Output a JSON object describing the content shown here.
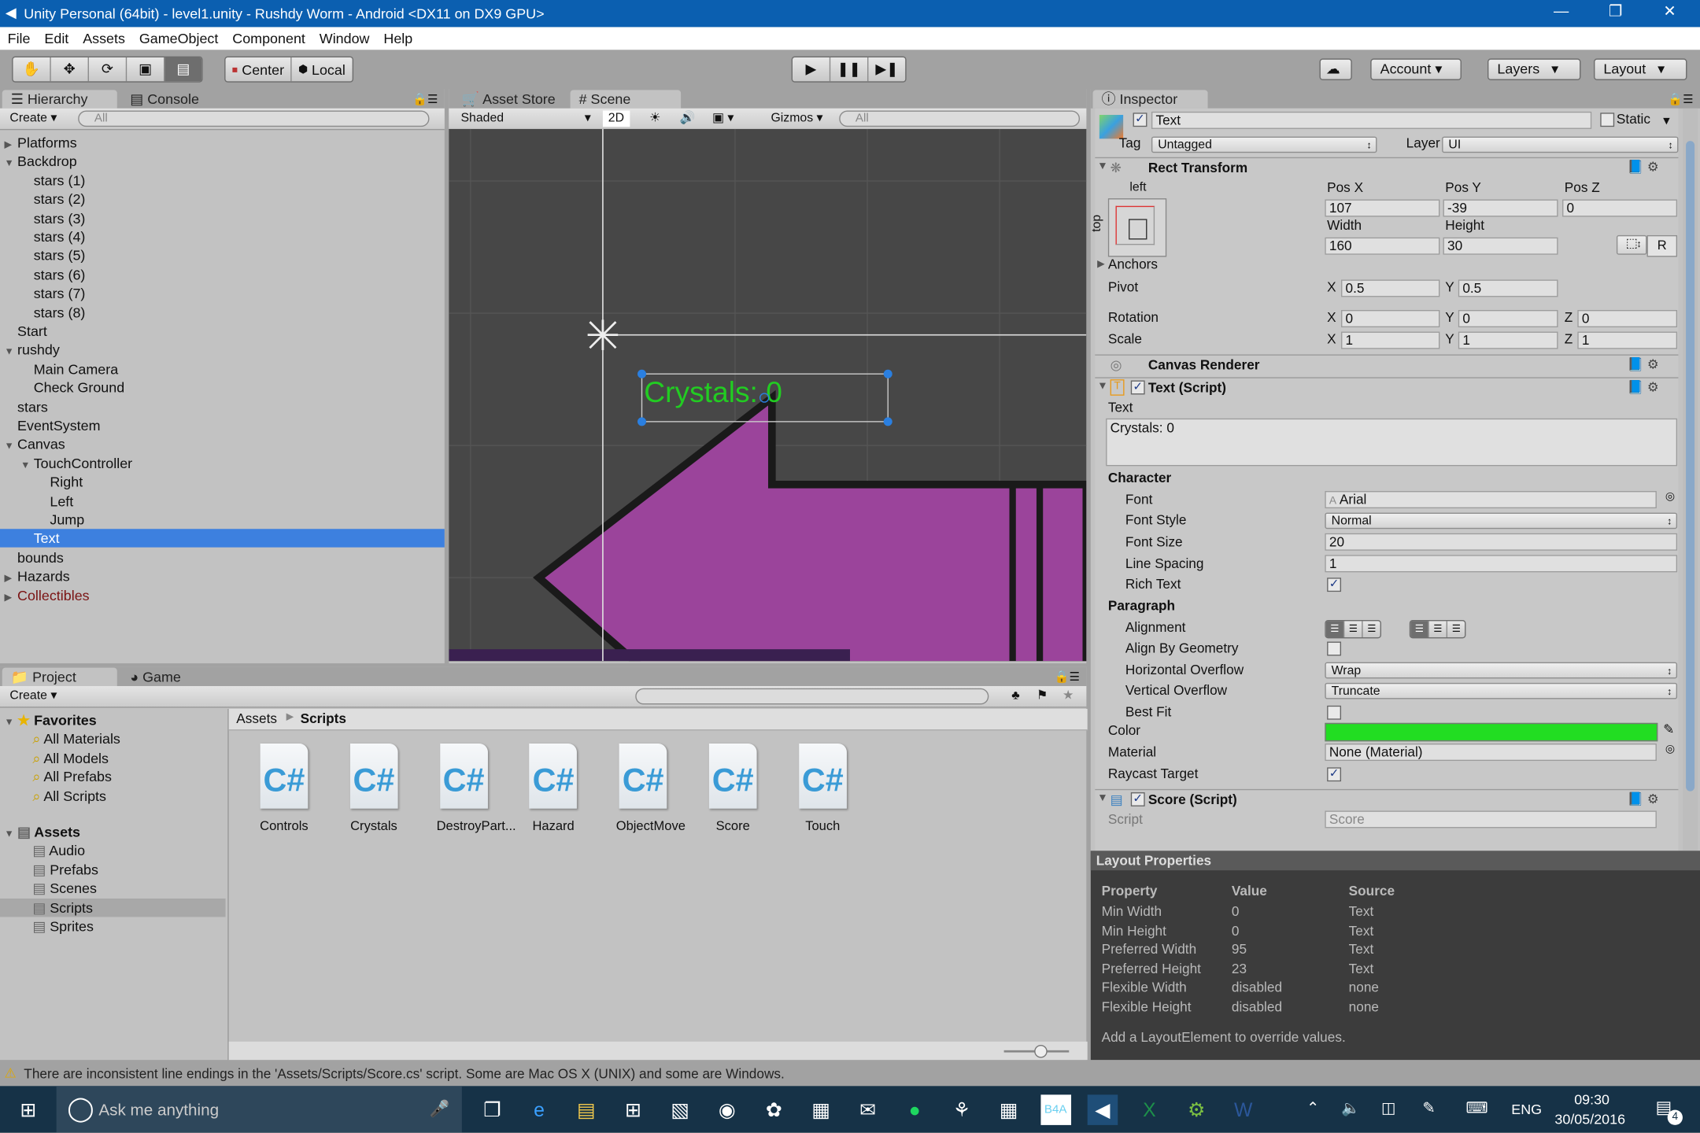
{
  "window": {
    "title": "Unity Personal (64bit) - level1.unity - Rushdy Worm - Android <DX11 on DX9 GPU>",
    "minimize": "—",
    "restore": "❐",
    "close": "✕"
  },
  "menu": [
    "File",
    "Edit",
    "Assets",
    "GameObject",
    "Component",
    "Window",
    "Help"
  ],
  "toolbar": {
    "tools": [
      "hand-tool",
      "move-tool",
      "rotate-tool",
      "scale-tool",
      "rect-tool"
    ],
    "active_tool": "rect-tool",
    "pivot_mode": "Center",
    "pivot_rotation": "Local",
    "account": "Account",
    "layers": "Layers",
    "layout": "Layout"
  },
  "hierarchy": {
    "tab": "Hierarchy",
    "console_tab": "Console",
    "create": "Create",
    "search_placeholder": "All",
    "items": [
      {
        "label": "Platforms",
        "depth": 0,
        "arrow": "collapsed"
      },
      {
        "label": "Backdrop",
        "depth": 0,
        "arrow": "expanded"
      },
      {
        "label": "stars (1)",
        "depth": 1
      },
      {
        "label": "stars (2)",
        "depth": 1
      },
      {
        "label": "stars (3)",
        "depth": 1
      },
      {
        "label": "stars (4)",
        "depth": 1
      },
      {
        "label": "stars (5)",
        "depth": 1
      },
      {
        "label": "stars (6)",
        "depth": 1
      },
      {
        "label": "stars (7)",
        "depth": 1
      },
      {
        "label": "stars (8)",
        "depth": 1
      },
      {
        "label": "Start",
        "depth": 0
      },
      {
        "label": "rushdy",
        "depth": 0,
        "arrow": "expanded"
      },
      {
        "label": "Main Camera",
        "depth": 1
      },
      {
        "label": "Check Ground",
        "depth": 1
      },
      {
        "label": "stars",
        "depth": 0
      },
      {
        "label": "EventSystem",
        "depth": 0
      },
      {
        "label": "Canvas",
        "depth": 0,
        "arrow": "expanded"
      },
      {
        "label": "TouchController",
        "depth": 1,
        "arrow": "expanded"
      },
      {
        "label": "Right",
        "depth": 2
      },
      {
        "label": "Left",
        "depth": 2
      },
      {
        "label": "Jump",
        "depth": 2
      },
      {
        "label": "Text",
        "depth": 1,
        "selected": true
      },
      {
        "label": "bounds",
        "depth": 0
      },
      {
        "label": "Hazards",
        "depth": 0,
        "arrow": "collapsed"
      },
      {
        "label": "Collectibles",
        "depth": 0,
        "arrow": "collapsed",
        "prefab_broken": true
      }
    ]
  },
  "scene": {
    "asset_store_tab": "Asset Store",
    "tab": "Scene",
    "shading": "Shaded",
    "mode_2d": "2D",
    "gizmos": "Gizmos",
    "search_placeholder": "All",
    "ui_text": "Crystals: 0",
    "ui_text_color": "#22cc22",
    "shape_color": "#9b449b"
  },
  "project": {
    "tab": "Project",
    "game_tab": "Game",
    "create": "Create",
    "favorites": {
      "label": "Favorites",
      "items": [
        "All Materials",
        "All Models",
        "All Prefabs",
        "All Scripts"
      ]
    },
    "assets": {
      "label": "Assets",
      "items": [
        "Audio",
        "Prefabs",
        "Scenes",
        "Scripts",
        "Sprites"
      ],
      "selected": "Scripts"
    },
    "breadcrumb": [
      "Assets",
      "Scripts"
    ],
    "files": [
      "Controls",
      "Crystals",
      "DestroyPart...",
      "Hazard",
      "ObjectMove",
      "Score",
      "Touch"
    ],
    "file_icon": "C#"
  },
  "inspector": {
    "tab": "Inspector",
    "name": "Text",
    "active": true,
    "static_label": "Static",
    "tag_label": "Tag",
    "tag": "Untagged",
    "layer_label": "Layer",
    "layer": "UI",
    "rect_transform": {
      "title": "Rect Transform",
      "anchor_h": "left",
      "anchor_v": "top",
      "pos_x_label": "Pos X",
      "pos_y_label": "Pos Y",
      "pos_z_label": "Pos Z",
      "pos_x": "107",
      "pos_y": "-39",
      "pos_z": "0",
      "width_label": "Width",
      "height_label": "Height",
      "width": "160",
      "height": "30",
      "raw_btn": "R",
      "anchors": "Anchors",
      "pivot": "Pivot",
      "pivot_x": "0.5",
      "pivot_y": "0.5",
      "rotation": "Rotation",
      "rot_x": "0",
      "rot_y": "0",
      "rot_z": "0",
      "scale": "Scale",
      "scale_x": "1",
      "scale_y": "1",
      "scale_z": "1",
      "x": "X",
      "y": "Y",
      "z": "Z"
    },
    "canvas_renderer": {
      "title": "Canvas Renderer"
    },
    "text_script": {
      "title": "Text (Script)",
      "text_label": "Text",
      "text": "Crystals: 0",
      "character": "Character",
      "font_label": "Font",
      "font": "Arial",
      "font_style_label": "Font Style",
      "font_style": "Normal",
      "font_size_label": "Font Size",
      "font_size": "20",
      "line_spacing_label": "Line Spacing",
      "line_spacing": "1",
      "rich_text_label": "Rich Text",
      "rich_text": true,
      "paragraph": "Paragraph",
      "alignment_label": "Alignment",
      "align_geometry_label": "Align By Geometry",
      "align_geometry": false,
      "h_overflow_label": "Horizontal Overflow",
      "h_overflow": "Wrap",
      "v_overflow_label": "Vertical Overflow",
      "v_overflow": "Truncate",
      "best_fit_label": "Best Fit",
      "best_fit": false,
      "color_label": "Color",
      "color": "#22dd22",
      "material_label": "Material",
      "material": "None (Material)",
      "raycast_label": "Raycast Target",
      "raycast": true
    },
    "score_script": {
      "title": "Score (Script)",
      "script_label": "Script",
      "script": "Score"
    },
    "layout_properties": {
      "title": "Layout Properties",
      "headers": [
        "Property",
        "Value",
        "Source"
      ],
      "rows": [
        [
          "Min Width",
          "0",
          "Text"
        ],
        [
          "Min Height",
          "0",
          "Text"
        ],
        [
          "Preferred Width",
          "95",
          "Text"
        ],
        [
          "Preferred Height",
          "23",
          "Text"
        ],
        [
          "Flexible Width",
          "disabled",
          "none"
        ],
        [
          "Flexible Height",
          "disabled",
          "none"
        ]
      ],
      "footer": "Add a LayoutElement to override values."
    }
  },
  "status": {
    "message": "There are inconsistent line endings in the 'Assets/Scripts/Score.cs' script. Some are Mac OS X (UNIX) and some are Windows."
  },
  "taskbar": {
    "search_placeholder": "Ask me anything",
    "language": "ENG",
    "time": "09:30",
    "date": "30/05/2016",
    "notifications": "4",
    "apps": [
      "task-view",
      "edge",
      "file-explorer",
      "store",
      "notepad",
      "steam",
      "paint",
      "calculator",
      "mail",
      "spotify",
      "gimp",
      "calendar",
      "b4a",
      "unity",
      "excel",
      "android-studio",
      "word"
    ]
  }
}
